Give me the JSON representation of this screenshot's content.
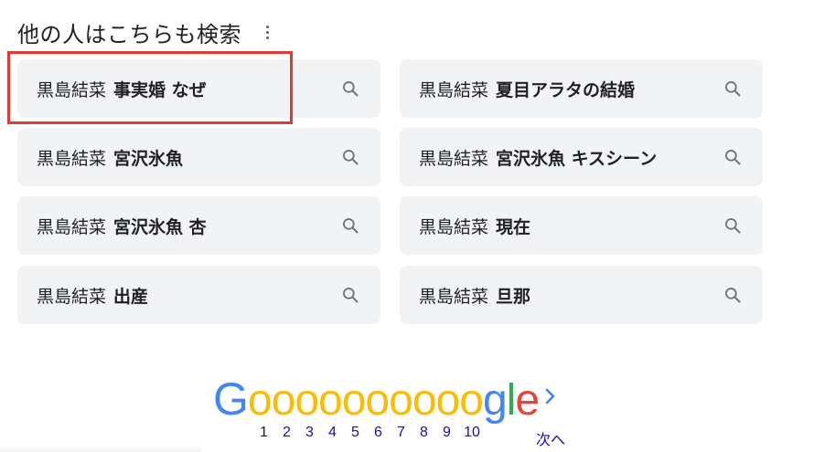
{
  "heading": {
    "title": "他の人はこちらも検索"
  },
  "related_searches": [
    {
      "query": "黒島結菜",
      "suffix": "事実婚 なぜ"
    },
    {
      "query": "黒島結菜",
      "suffix": "夏目アラタの結婚"
    },
    {
      "query": "黒島結菜",
      "suffix": "宮沢氷魚"
    },
    {
      "query": "黒島結菜",
      "suffix": "宮沢氷魚 キスシーン"
    },
    {
      "query": "黒島結菜",
      "suffix": "宮沢氷魚 杏"
    },
    {
      "query": "黒島結菜",
      "suffix": "現在"
    },
    {
      "query": "黒島結菜",
      "suffix": "出産"
    },
    {
      "query": "黒島結菜",
      "suffix": "旦那"
    }
  ],
  "pagination": {
    "logo": {
      "G": "G",
      "o": "o",
      "g": "g",
      "l": "l",
      "e": "e"
    },
    "current_page": "1",
    "pages": [
      "1",
      "2",
      "3",
      "4",
      "5",
      "6",
      "7",
      "8",
      "9",
      "10"
    ],
    "next_label": "次へ",
    "next_icon": "chevron-right-icon"
  },
  "colors": {
    "chip_bg": "#f1f3f4",
    "highlight": "#e53935",
    "link": "#1a0dab",
    "google_blue": "#4285f4",
    "google_yellow": "#fbbc05",
    "google_green": "#34a853",
    "google_red": "#ea4335"
  }
}
